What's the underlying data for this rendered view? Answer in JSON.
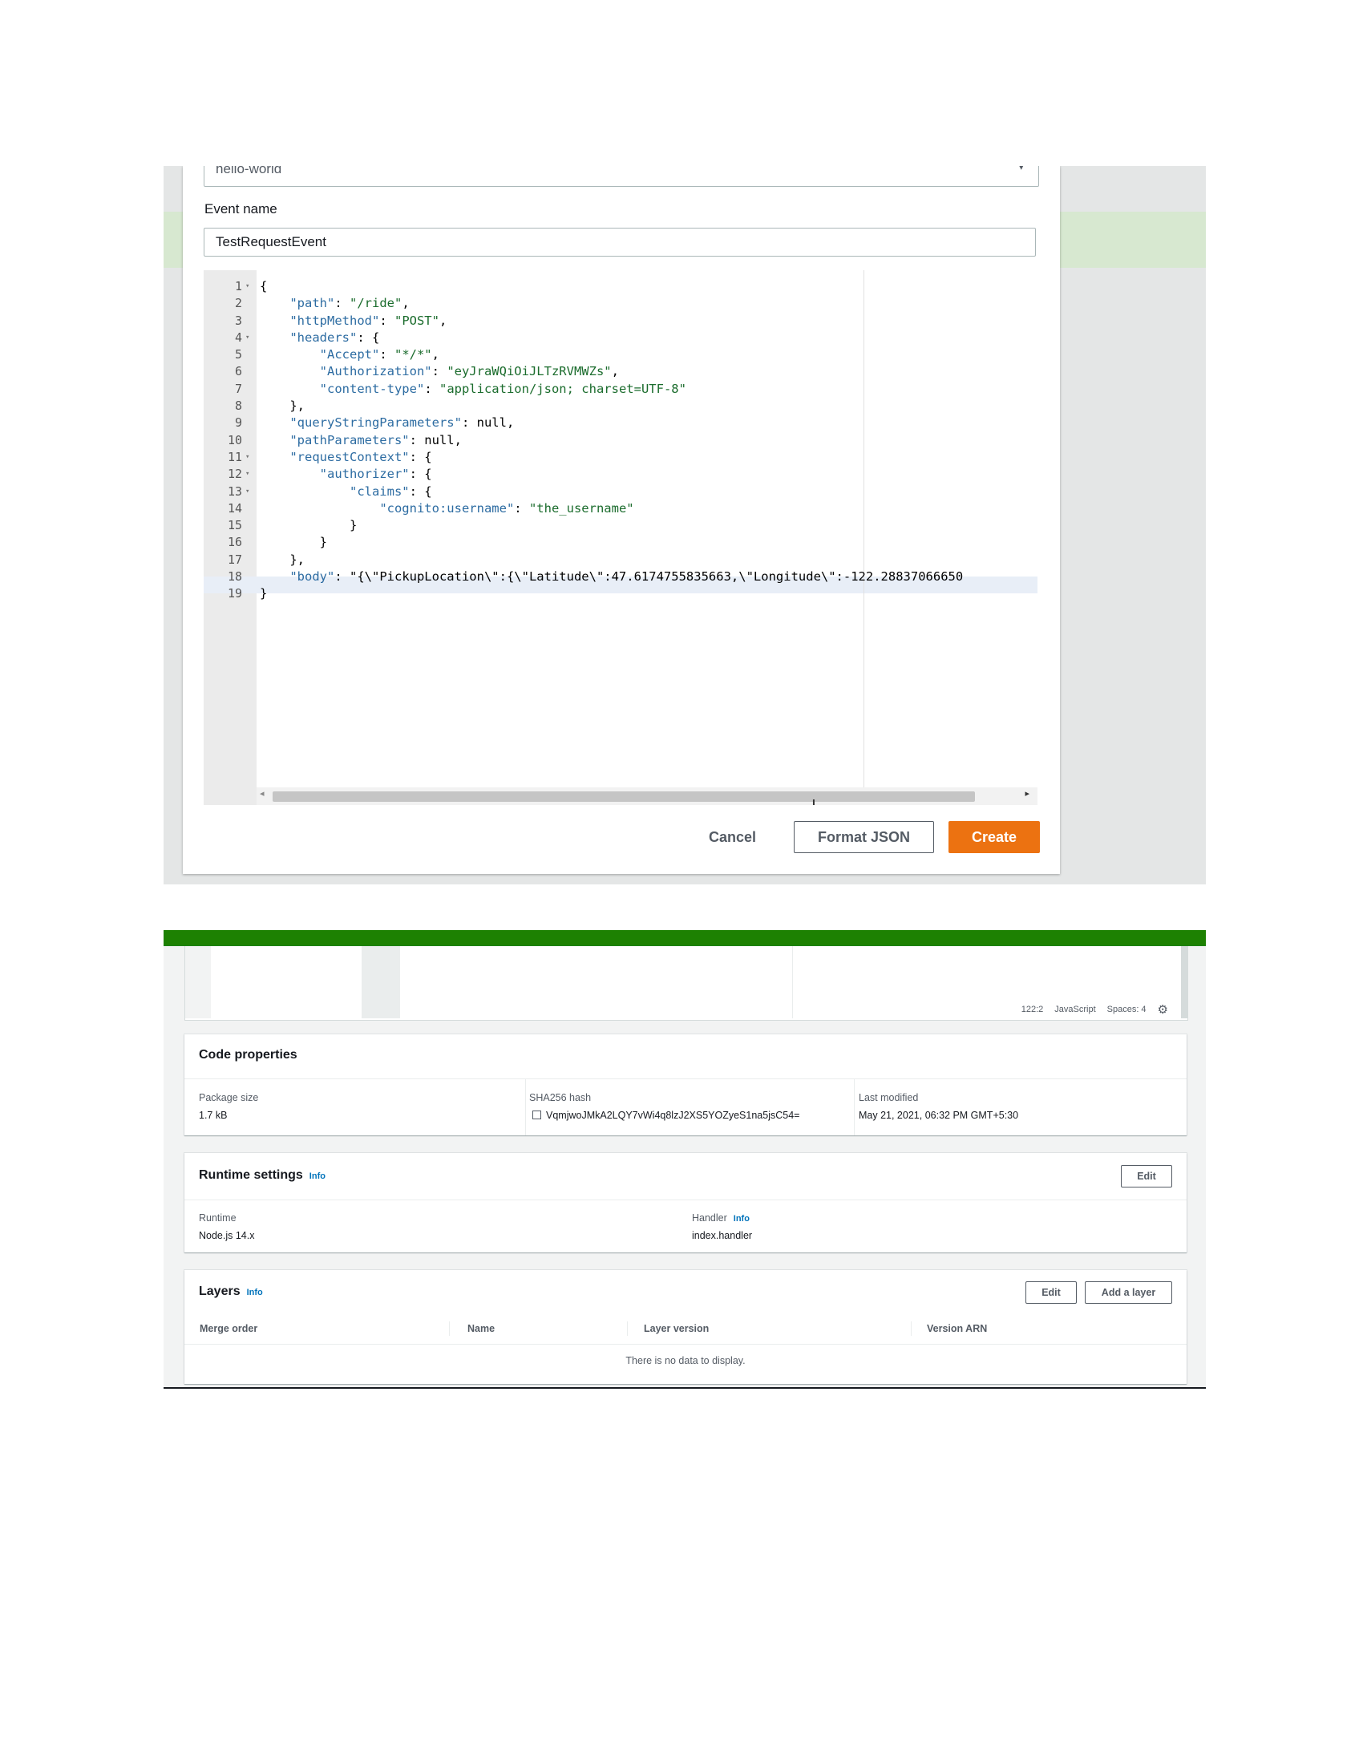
{
  "test_event_modal": {
    "template_select_value": "hello-world",
    "event_name_label": "Event name",
    "event_name_value": "TestRequestEvent",
    "code_lines": [
      {
        "n": "1",
        "fold": true,
        "text": "{"
      },
      {
        "n": "2",
        "fold": false,
        "text": "    \"path\": \"/ride\","
      },
      {
        "n": "3",
        "fold": false,
        "text": "    \"httpMethod\": \"POST\","
      },
      {
        "n": "4",
        "fold": true,
        "text": "    \"headers\": {"
      },
      {
        "n": "5",
        "fold": false,
        "text": "        \"Accept\": \"*/*\","
      },
      {
        "n": "6",
        "fold": false,
        "text": "        \"Authorization\": \"eyJraWQiOiJLTzRVMWZs\","
      },
      {
        "n": "7",
        "fold": false,
        "text": "        \"content-type\": \"application/json; charset=UTF-8\""
      },
      {
        "n": "8",
        "fold": false,
        "text": "    },"
      },
      {
        "n": "9",
        "fold": false,
        "text": "    \"queryStringParameters\": null,"
      },
      {
        "n": "10",
        "fold": false,
        "text": "    \"pathParameters\": null,"
      },
      {
        "n": "11",
        "fold": true,
        "text": "    \"requestContext\": {"
      },
      {
        "n": "12",
        "fold": true,
        "text": "        \"authorizer\": {"
      },
      {
        "n": "13",
        "fold": true,
        "text": "            \"claims\": {"
      },
      {
        "n": "14",
        "fold": false,
        "text": "                \"cognito:username\": \"the_username\""
      },
      {
        "n": "15",
        "fold": false,
        "text": "            }"
      },
      {
        "n": "16",
        "fold": false,
        "text": "        }"
      },
      {
        "n": "17",
        "fold": false,
        "text": "    },"
      },
      {
        "n": "18",
        "fold": false,
        "text": "    \"body\": \"{\\\"PickupLocation\\\":{\\\"Latitude\\\":47.6174755835663,\\\"Longitude\\\":-122.28837066650"
      },
      {
        "n": "19",
        "fold": false,
        "text": "}"
      }
    ],
    "active_line": 19,
    "cancel_label": "Cancel",
    "format_json_label": "Format JSON",
    "create_label": "Create"
  },
  "function_page": {
    "editor_status": {
      "position": "122:2",
      "language": "JavaScript",
      "spaces": "Spaces: 4",
      "settings_icon": "gear-icon"
    },
    "code_properties": {
      "title": "Code properties",
      "package_size_label": "Package size",
      "package_size_value": "1.7 kB",
      "sha_label": "SHA256 hash",
      "sha_value": "VqmjwoJMkA2LQY7vWi4q8lzJ2XS5YOZyeS1na5jsC54=",
      "sha_icon": "copy-icon",
      "last_modified_label": "Last modified",
      "last_modified_value": "May 21, 2021, 06:32 PM GMT+5:30"
    },
    "runtime_settings": {
      "title": "Runtime settings",
      "info_label": "Info",
      "edit_label": "Edit",
      "runtime_label": "Runtime",
      "runtime_value": "Node.js 14.x",
      "handler_label": "Handler",
      "handler_info_label": "Info",
      "handler_value": "index.handler"
    },
    "layers": {
      "title": "Layers",
      "info_label": "Info",
      "edit_label": "Edit",
      "add_layer_label": "Add a layer",
      "columns": [
        "Merge order",
        "Name",
        "Layer version",
        "Version ARN"
      ],
      "empty_message": "There is no data to display."
    }
  },
  "colors": {
    "primary_button": "#ec7211",
    "success_bar": "#1d8102",
    "link": "#0073bb"
  }
}
